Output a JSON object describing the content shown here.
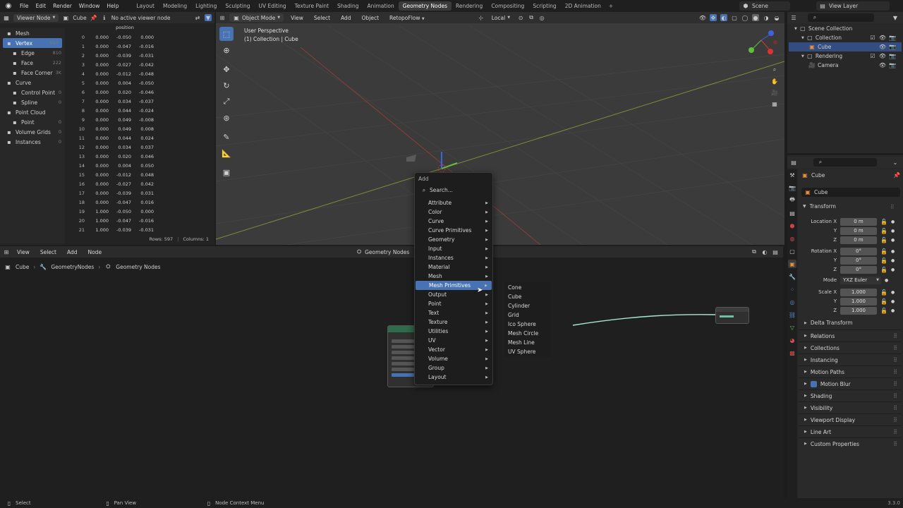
{
  "topbar": {
    "menus": [
      "File",
      "Edit",
      "Render",
      "Window",
      "Help"
    ],
    "workspaces": [
      "Layout",
      "Modeling",
      "Lighting",
      "Sculpting",
      "UV Editing",
      "Texture Paint",
      "Shading",
      "Animation",
      "Geometry Nodes",
      "Rendering",
      "Compositing",
      "Scripting",
      "2D Animation"
    ],
    "active_workspace": "Geometry Nodes",
    "scene": "Scene",
    "view_layer": "View Layer"
  },
  "spreadsheet": {
    "viewer": "Viewer Node",
    "object": "Cube",
    "no_viewer": "No active viewer node",
    "column_header": "position",
    "tree": [
      {
        "label": "Mesh",
        "count": "",
        "indent": 0,
        "sel": false
      },
      {
        "label": "Vertex",
        "count": "597",
        "indent": 1,
        "sel": true
      },
      {
        "label": "Edge",
        "count": "810",
        "indent": 1,
        "sel": false
      },
      {
        "label": "Face",
        "count": "222",
        "indent": 1,
        "sel": false
      },
      {
        "label": "Face Corner",
        "count": "3K",
        "indent": 1,
        "sel": false
      },
      {
        "label": "Curve",
        "count": "",
        "indent": 0,
        "sel": false
      },
      {
        "label": "Control Point",
        "count": "0",
        "indent": 1,
        "sel": false
      },
      {
        "label": "Spline",
        "count": "0",
        "indent": 1,
        "sel": false
      },
      {
        "label": "Point Cloud",
        "count": "",
        "indent": 0,
        "sel": false
      },
      {
        "label": "Point",
        "count": "0",
        "indent": 1,
        "sel": false
      },
      {
        "label": "Volume Grids",
        "count": "0",
        "indent": 0,
        "sel": false
      },
      {
        "label": "Instances",
        "count": "0",
        "indent": 0,
        "sel": false
      }
    ],
    "rows": [
      [
        "0",
        "0.000",
        "-0.050",
        "0.000"
      ],
      [
        "1",
        "0.000",
        "-0.047",
        "-0.016"
      ],
      [
        "2",
        "0.000",
        "-0.039",
        "-0.031"
      ],
      [
        "3",
        "0.000",
        "-0.027",
        "-0.042"
      ],
      [
        "4",
        "0.000",
        "-0.012",
        "-0.048"
      ],
      [
        "5",
        "0.000",
        "0.004",
        "-0.050"
      ],
      [
        "6",
        "0.000",
        "0.020",
        "-0.046"
      ],
      [
        "7",
        "0.000",
        "0.034",
        "-0.037"
      ],
      [
        "8",
        "0.000",
        "0.044",
        "-0.024"
      ],
      [
        "9",
        "0.000",
        "0.049",
        "-0.008"
      ],
      [
        "10",
        "0.000",
        "0.049",
        "0.008"
      ],
      [
        "11",
        "0.000",
        "0.044",
        "0.024"
      ],
      [
        "12",
        "0.000",
        "0.034",
        "0.037"
      ],
      [
        "13",
        "0.000",
        "0.020",
        "0.046"
      ],
      [
        "14",
        "0.000",
        "0.004",
        "0.050"
      ],
      [
        "15",
        "0.000",
        "-0.012",
        "0.048"
      ],
      [
        "16",
        "0.000",
        "-0.027",
        "0.042"
      ],
      [
        "17",
        "0.000",
        "-0.039",
        "0.031"
      ],
      [
        "18",
        "0.000",
        "-0.047",
        "0.016"
      ],
      [
        "19",
        "1.000",
        "-0.050",
        "0.000"
      ],
      [
        "20",
        "1.000",
        "-0.047",
        "-0.016"
      ],
      [
        "21",
        "1.000",
        "-0.039",
        "-0.031"
      ]
    ],
    "rows_label": "Rows: 597",
    "columns_label": "Columns: 1"
  },
  "viewport": {
    "mode": "Object Mode",
    "menus": [
      "View",
      "Select",
      "Add",
      "Object"
    ],
    "retopo": "RetopoFlow",
    "transform": "Local",
    "perspective": "User Perspective",
    "collection": "(1) Collection | Cube"
  },
  "node_editor": {
    "menus": [
      "View",
      "Select",
      "Add",
      "Node"
    ],
    "editor_type": "Geometry Nodes",
    "breadcrumb": [
      "Cube",
      "GeometryNodes",
      "Geometry Nodes"
    ]
  },
  "add_menu": {
    "title": "Add",
    "search": "Search...",
    "items": [
      "Attribute",
      "Color",
      "Curve",
      "Curve Primitives",
      "Geometry",
      "Input",
      "Instances",
      "Material",
      "Mesh",
      "Mesh Primitives",
      "Output",
      "Point",
      "Text",
      "Texture",
      "Utilities",
      "UV",
      "Vector",
      "Volume",
      "Group",
      "Layout"
    ],
    "highlighted": "Mesh Primitives",
    "submenu": [
      "Cone",
      "Cube",
      "Cylinder",
      "Grid",
      "Ico Sphere",
      "Mesh Circle",
      "Mesh Line",
      "UV Sphere"
    ]
  },
  "outliner": {
    "rows": [
      {
        "label": "Scene Collection",
        "indent": 0
      },
      {
        "label": "Collection",
        "indent": 1
      },
      {
        "label": "Cube",
        "indent": 2
      },
      {
        "label": "Rendering",
        "indent": 1
      },
      {
        "label": "Camera",
        "indent": 2
      }
    ]
  },
  "properties": {
    "object_name": "Cube",
    "datablock": "Cube",
    "transform_label": "Transform",
    "location": {
      "label": "Location X",
      "y": "Y",
      "z": "Z",
      "values": [
        "0 m",
        "0 m",
        "0 m"
      ]
    },
    "rotation": {
      "label": "Rotation X",
      "y": "Y",
      "z": "Z",
      "values": [
        "0°",
        "0°",
        "0°"
      ]
    },
    "mode_label": "Mode",
    "mode_value": "YXZ Euler",
    "scale": {
      "label": "Scale X",
      "y": "Y",
      "z": "Z",
      "values": [
        "1.000",
        "1.000",
        "1.000"
      ]
    },
    "delta": "Delta Transform",
    "panels": [
      "Relations",
      "Collections",
      "Instancing",
      "Motion Paths",
      "Motion Blur",
      "Shading",
      "Visibility",
      "Viewport Display",
      "Line Art",
      "Custom Properties"
    ]
  },
  "status": {
    "select": "Select",
    "pan": "Pan View",
    "context": "Node Context Menu",
    "version": "3.3.0"
  }
}
